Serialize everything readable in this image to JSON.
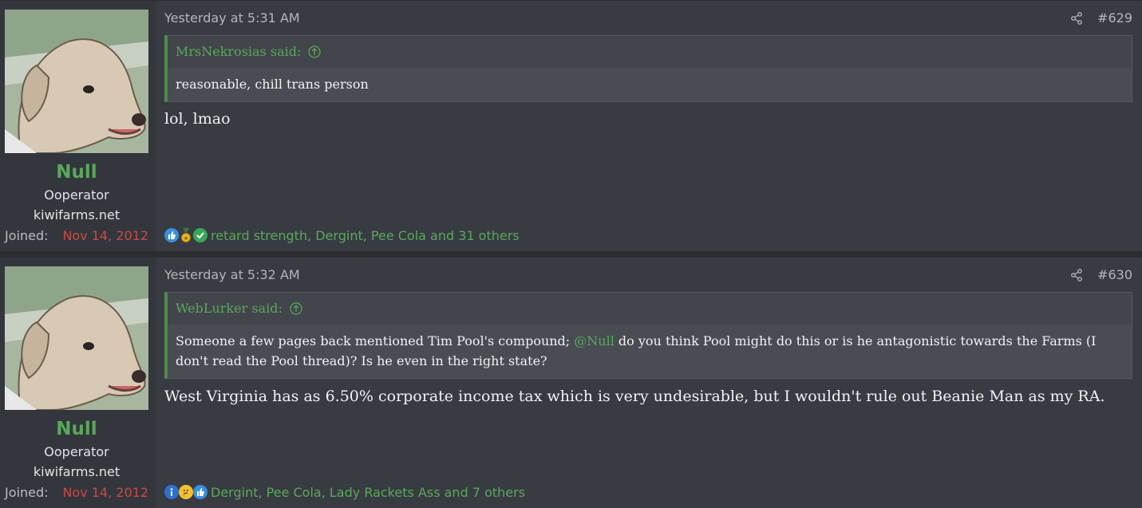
{
  "posts": [
    {
      "user": {
        "name": "Null",
        "title": "Ooperator",
        "site": "kiwifarms.net",
        "joined_label": "Joined:",
        "joined_date": "Nov 14, 2012"
      },
      "timestamp": "Yesterday at 5:31 AM",
      "post_number": "#629",
      "quote": {
        "author": "MrsNekrosias said:",
        "text": "reasonable, chill trans person"
      },
      "message": "lol, lmao",
      "reactions": {
        "icons": [
          "like-icon",
          "medal-icon",
          "checkmark-icon"
        ],
        "text": "retard strength, Dergint, Pee Cola and 31 others"
      }
    },
    {
      "user": {
        "name": "Null",
        "title": "Ooperator",
        "site": "kiwifarms.net",
        "joined_label": "Joined:",
        "joined_date": "Nov 14, 2012"
      },
      "timestamp": "Yesterday at 5:32 AM",
      "post_number": "#630",
      "quote": {
        "author": "WebLurker said:",
        "text_before": "Someone a few pages back mentioned Tim Pool's compound; ",
        "mention": "@Null",
        "text_after": " do you think Pool might do this or is he antagonistic towards the Farms (I don't read the Pool thread)? Is he even in the right state?"
      },
      "message": "West Virginia has as 6.50% corporate income tax which is very undesirable, but I wouldn't rule out Beanie Man as my RA.",
      "reactions": {
        "icons": [
          "informative-icon",
          "thinking-icon",
          "like-icon"
        ],
        "text": "Dergint, Pee Cola, Lady Rackets Ass and 7 others"
      }
    }
  ],
  "colors": {
    "accent_green": "#5aa85a",
    "joined_red": "#c94a44",
    "background": "#383b42"
  }
}
